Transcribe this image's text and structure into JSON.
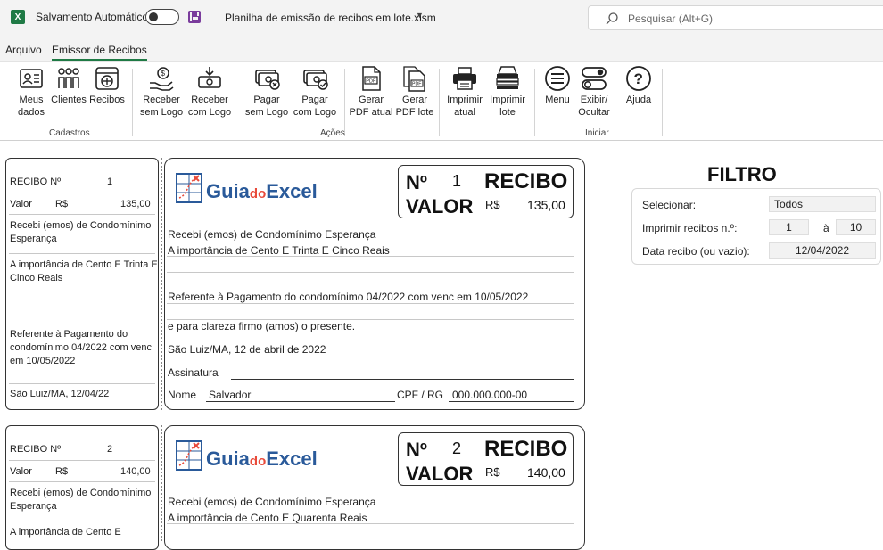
{
  "titlebar": {
    "app_icon": "excel-icon",
    "autosave_label": "Salvamento Automático",
    "filename": "Planilha de emissão de recibos em lote.xlsm",
    "search_placeholder": "Pesquisar (Alt+G)"
  },
  "menu": {
    "tabs": [
      {
        "label": "Arquivo"
      },
      {
        "label": "Emissor de Recibos"
      }
    ]
  },
  "ribbon": {
    "groups": [
      {
        "label": "Cadastros"
      },
      {
        "label": "Ações"
      },
      {
        "label": "Iniciar"
      }
    ],
    "buttons": [
      {
        "label": "Meus\ndados",
        "icon": "user-card-icon"
      },
      {
        "label": "Clientes",
        "icon": "people-icon"
      },
      {
        "label": "Recibos",
        "icon": "receipt-register-icon"
      },
      {
        "label": "Receber\nsem Logo",
        "icon": "receive-money-icon"
      },
      {
        "label": "Receber\ncom Logo",
        "icon": "receive-money-logo-icon"
      },
      {
        "label": "Pagar\nsem Logo",
        "icon": "pay-money-icon"
      },
      {
        "label": "Pagar\ncom Logo",
        "icon": "pay-money-logo-icon"
      },
      {
        "label": "Gerar\nPDF atual",
        "icon": "pdf-icon"
      },
      {
        "label": "Gerar\nPDF lote",
        "icon": "pdf-batch-icon"
      },
      {
        "label": "Imprimir\natual",
        "icon": "printer-icon"
      },
      {
        "label": "Imprimir\nlote",
        "icon": "printer-batch-icon"
      },
      {
        "label": "Menu",
        "icon": "menu-icon"
      },
      {
        "label": "Exibir/\nOcultar",
        "icon": "toggle-icon"
      },
      {
        "label": "Ajuda",
        "icon": "help-icon"
      }
    ]
  },
  "receipts": [
    {
      "stub": {
        "recibo_label": "RECIBO Nº",
        "numero": "1",
        "valor_label": "Valor",
        "currency": "R$",
        "valor": "135,00",
        "recebi_line1": "Recebi (emos) de Condomínimo",
        "recebi_line2": "Esperança",
        "importancia_line1": "A importância de Cento E Trinta E",
        "importancia_line2": "Cinco Reais",
        "referente_line1": "Referente à Pagamento do",
        "referente_line2": "condomínimo 04/2022 com venc",
        "referente_line3": "em 10/05/2022",
        "local_data": "São Luiz/MA, 12/04/22"
      },
      "main": {
        "logo_text_a": "Guia",
        "logo_text_b": "do",
        "logo_text_c": "Excel",
        "num_label": "Nº",
        "numero": "1",
        "recibo_title": "RECIBO",
        "valor_label": "VALOR",
        "currency": "R$",
        "valor": "135,00",
        "recebi": "Recebi (emos) de Condomínimo Esperança",
        "importancia": "A importância de Cento E Trinta E Cinco Reais",
        "referente": "Referente à Pagamento do condomínimo 04/2022 com venc em 10/05/2022",
        "clareza": "e para clareza firmo (amos) o presente.",
        "local_data": "São Luiz/MA, 12 de abril de 2022",
        "assinatura_label": "Assinatura",
        "nome_label": "Nome",
        "nome": "Salvador",
        "cpf_label": "CPF / RG",
        "cpf": "000.000.000-00"
      }
    },
    {
      "stub": {
        "recibo_label": "RECIBO Nº",
        "numero": "2",
        "valor_label": "Valor",
        "currency": "R$",
        "valor": "140,00",
        "recebi_line1": "Recebi (emos) de Condomínimo",
        "recebi_line2": "Esperança",
        "importancia_line1": "A importância de Cento E"
      },
      "main": {
        "logo_text_a": "Guia",
        "logo_text_b": "do",
        "logo_text_c": "Excel",
        "num_label": "Nº",
        "numero": "2",
        "recibo_title": "RECIBO",
        "valor_label": "VALOR",
        "currency": "R$",
        "valor": "140,00",
        "recebi": "Recebi (emos) de Condomínimo Esperança",
        "importancia": "A importância de Cento E Quarenta Reais"
      }
    }
  ],
  "filtro": {
    "title": "FILTRO",
    "selecionar_label": "Selecionar:",
    "selecionar_value": "Todos",
    "imprimir_label": "Imprimir recibos n.º:",
    "imprimir_from": "1",
    "imprimir_sep": "à",
    "imprimir_to": "10",
    "data_label": "Data recibo (ou vazio):",
    "data_value": "12/04/2022"
  },
  "colors": {
    "excel_green": "#1f7a45",
    "logo_blue": "#2a5a9a",
    "logo_red": "#e84a3a",
    "save_purple": "#7a3c9c"
  }
}
